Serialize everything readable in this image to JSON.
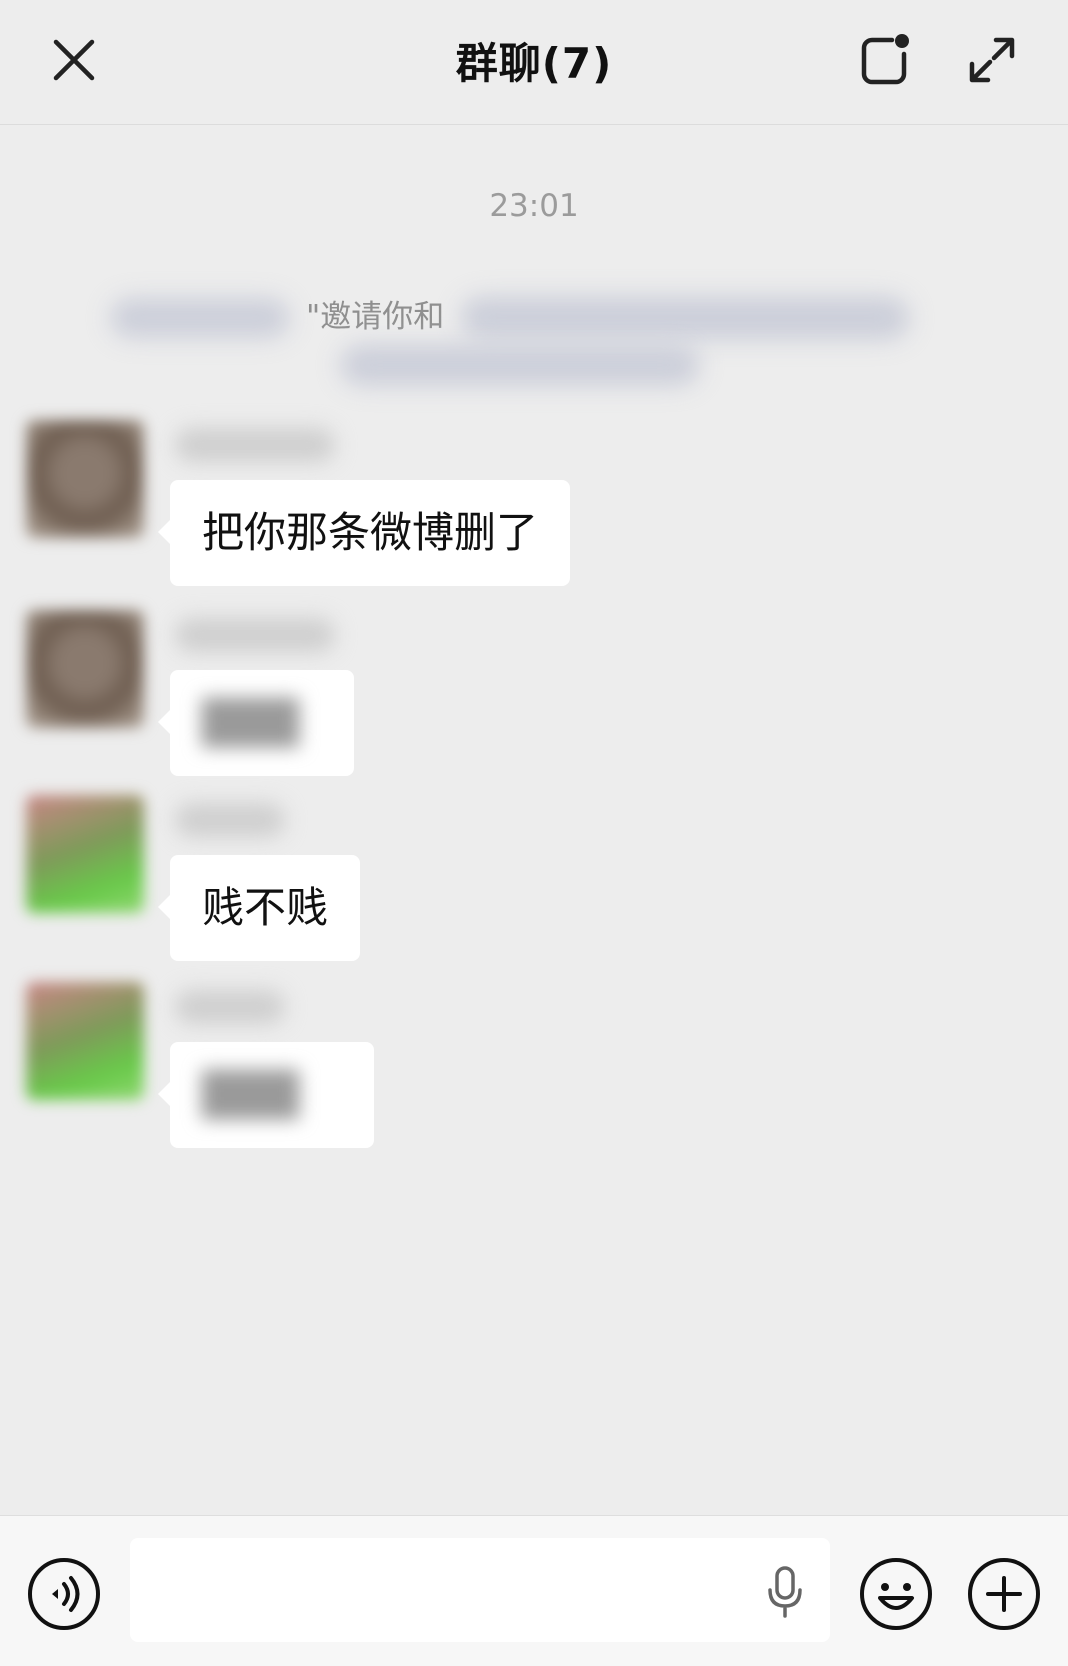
{
  "header": {
    "title": "群聊(7)",
    "close_icon": "close-icon",
    "window_icon": "floating-window-icon",
    "expand_icon": "expand-icon"
  },
  "timestamp": "23:01",
  "system_notice": {
    "text": "\"邀请你和"
  },
  "messages": [
    {
      "avatar": "avatar-a",
      "text": "把你那条微博删了",
      "blurred": false
    },
    {
      "avatar": "avatar-a",
      "text": "",
      "blurred": true
    },
    {
      "avatar": "avatar-b",
      "text": "贱不贱",
      "blurred": false
    },
    {
      "avatar": "avatar-b",
      "text": "",
      "blurred": true
    }
  ],
  "input_bar": {
    "voice_icon": "voice-mode-icon",
    "input_value": "",
    "mic_icon": "microphone-icon",
    "emoji_icon": "emoji-icon",
    "plus_icon": "plus-icon"
  },
  "colors": {
    "background": "#ededed",
    "bubble": "#ffffff",
    "muted_text": "#9b9b9b"
  }
}
